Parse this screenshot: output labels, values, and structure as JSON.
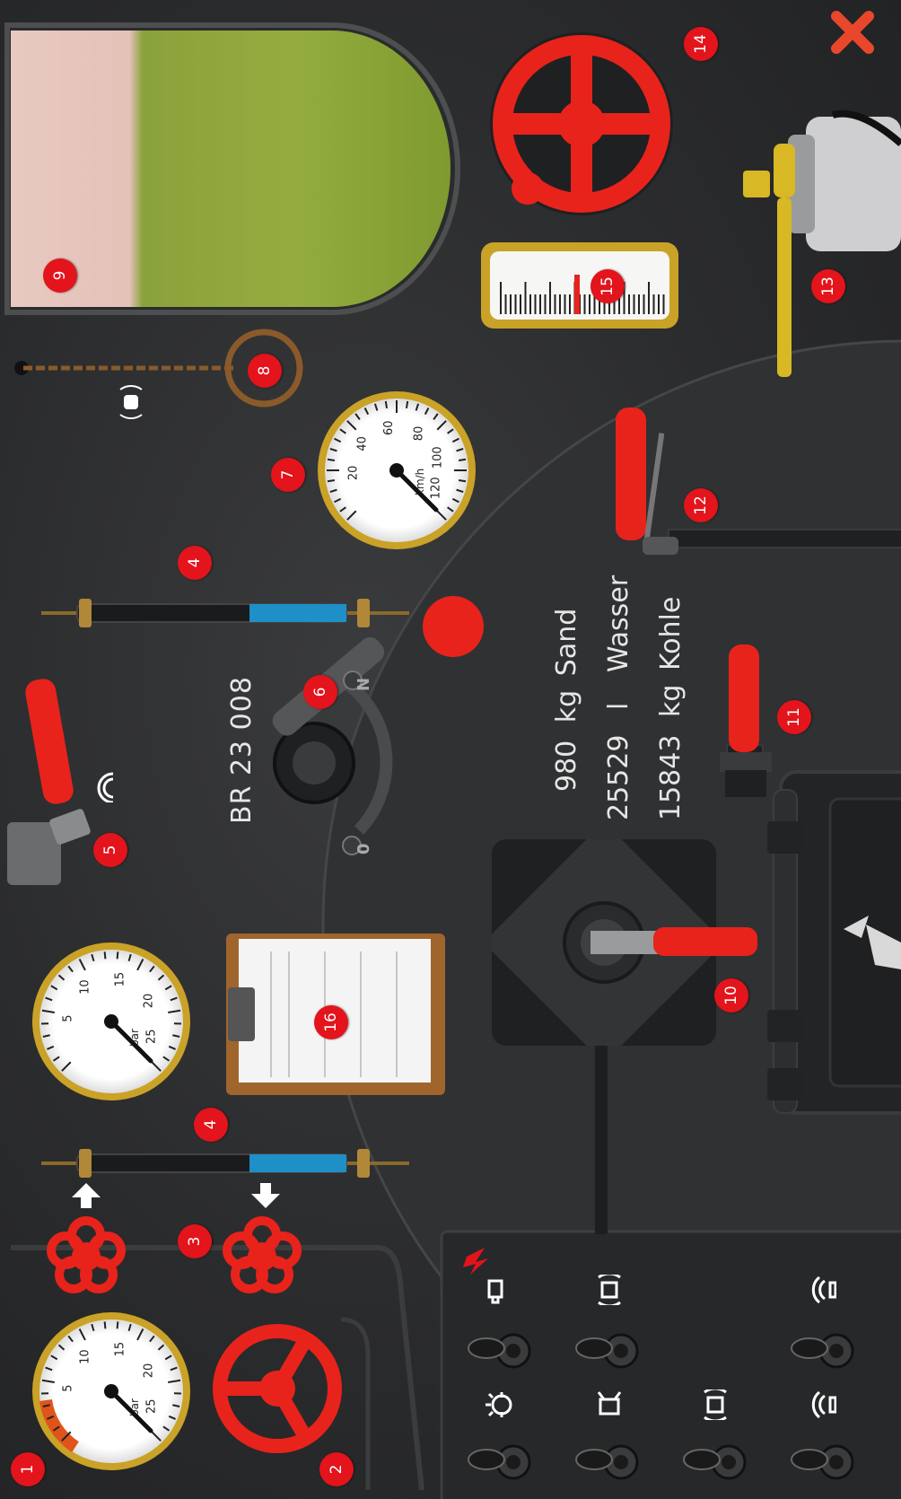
{
  "loco": {
    "name": "BR 23 008"
  },
  "supplies": [
    {
      "value": "980",
      "unit": "kg",
      "label": "Sand"
    },
    {
      "value": "25529",
      "unit": "l",
      "label": "Wasser"
    },
    {
      "value": "15843",
      "unit": "kg",
      "label": "Kohle"
    }
  ],
  "badges": [
    "1",
    "2",
    "3",
    "4",
    "4",
    "5",
    "6",
    "7",
    "8",
    "9",
    "10",
    "11",
    "12",
    "13",
    "14",
    "15",
    "16"
  ],
  "gauges": {
    "boiler": {
      "unit": "bar",
      "ticks": [
        "5",
        "10",
        "15",
        "20",
        "25"
      ]
    },
    "brake": {
      "unit": "bar",
      "ticks": [
        "5",
        "10",
        "15",
        "20",
        "25"
      ]
    },
    "speed": {
      "unit": "km/h",
      "ticks": [
        "20",
        "40",
        "60",
        "80",
        "100",
        "120"
      ]
    }
  },
  "reverser": {
    "neutral_label": "N",
    "zero_label": "0"
  },
  "colors": {
    "accent": "#e3141b",
    "handle": "#e8231b",
    "brass": "#c9a227",
    "water": "#1e8fc7"
  },
  "icons": [
    "close-icon",
    "lightning-icon",
    "wifi-horn-icon",
    "bell-icon",
    "light-icon",
    "sand-icon",
    "whistle-icon"
  ]
}
